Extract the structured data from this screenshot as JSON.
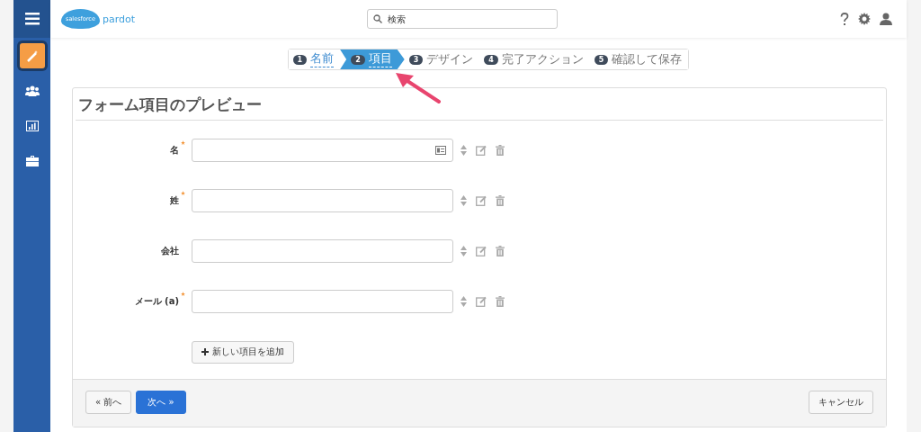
{
  "sidebar": {
    "items": [
      {
        "kind": "wand",
        "selected": true
      },
      {
        "kind": "people",
        "selected": false
      },
      {
        "kind": "chart",
        "selected": false
      },
      {
        "kind": "briefcase",
        "selected": false
      }
    ]
  },
  "header": {
    "logo": {
      "brand": "salesforce",
      "product": "pardot"
    },
    "search": {
      "placeholder": "検索"
    }
  },
  "wizard": {
    "steps": [
      {
        "number": "1",
        "label": "名前",
        "selected": false,
        "done": true
      },
      {
        "number": "2",
        "label": "項目",
        "selected": true,
        "done": true
      },
      {
        "number": "3",
        "label": "デザイン",
        "selected": false,
        "done": false
      },
      {
        "number": "4",
        "label": "完了アクション",
        "selected": false,
        "done": false
      },
      {
        "number": "5",
        "label": "確認して保存",
        "selected": false,
        "done": false
      }
    ]
  },
  "panel": {
    "title": "フォーム項目のプレビュー",
    "fields": [
      {
        "label": "名",
        "required": true,
        "card_icon": true
      },
      {
        "label": "姓",
        "required": true,
        "card_icon": false
      },
      {
        "label": "会社",
        "required": false,
        "card_icon": false
      },
      {
        "label": "メール (a)",
        "required": true,
        "card_icon": false
      }
    ],
    "add_button": "新しい項目を追加"
  },
  "footer": {
    "prev": "« 前へ",
    "next": "次へ »",
    "cancel": "キャンセル"
  }
}
